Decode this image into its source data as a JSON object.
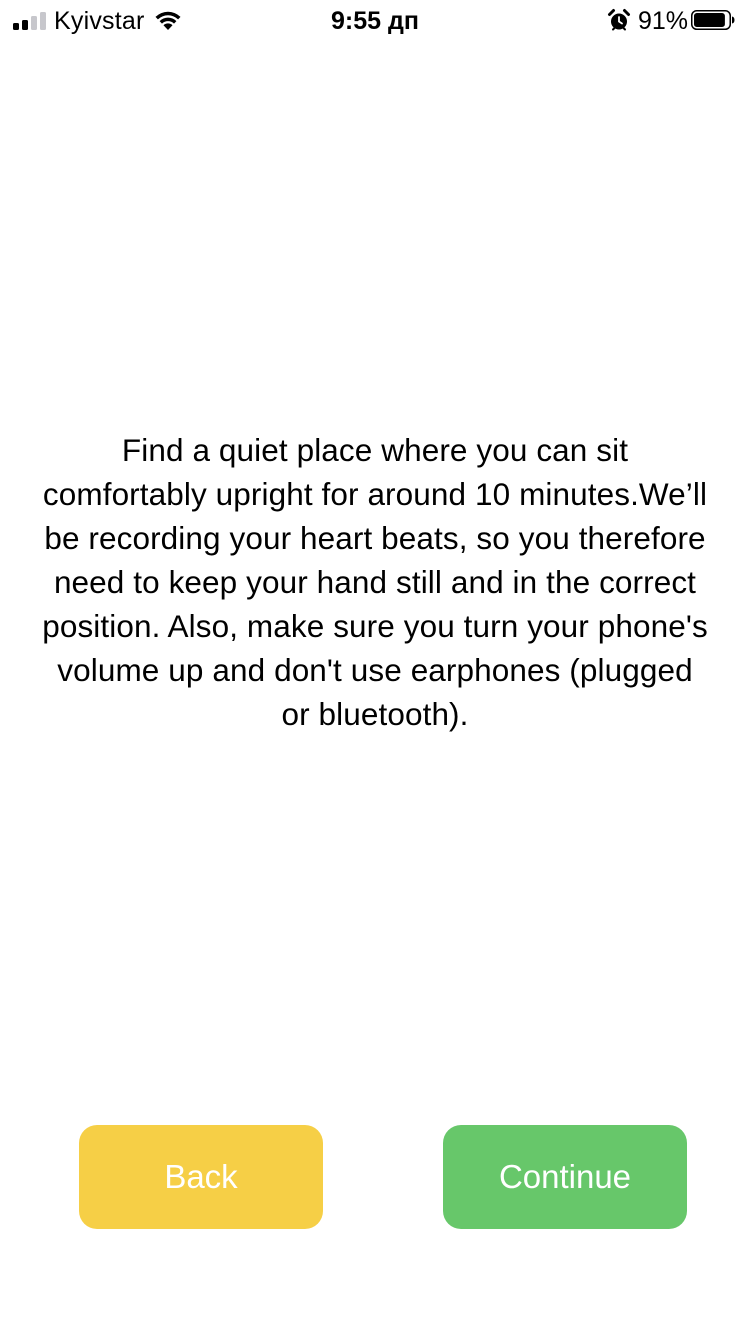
{
  "status_bar": {
    "carrier": "Kyivstar",
    "time": "9:55 дп",
    "battery_percent": "91%",
    "battery_level": 0.91,
    "signal_bars_active": 2,
    "signal_bars_total": 4,
    "icons": [
      "signal-icon",
      "wifi-icon",
      "alarm-icon",
      "battery-icon"
    ]
  },
  "instructions": {
    "text": "Find a quiet place where you can sit comfortably upright for around 10 minutes.We’ll be recording your heart beats, so you therefore need to keep your hand still and in the correct position. Also, make sure you turn your phone's volume up and don't use earphones (plugged or bluetooth)."
  },
  "buttons": {
    "back": {
      "label": "Back",
      "color": "#f6cf46"
    },
    "continue": {
      "label": "Continue",
      "color": "#67c76a"
    }
  }
}
